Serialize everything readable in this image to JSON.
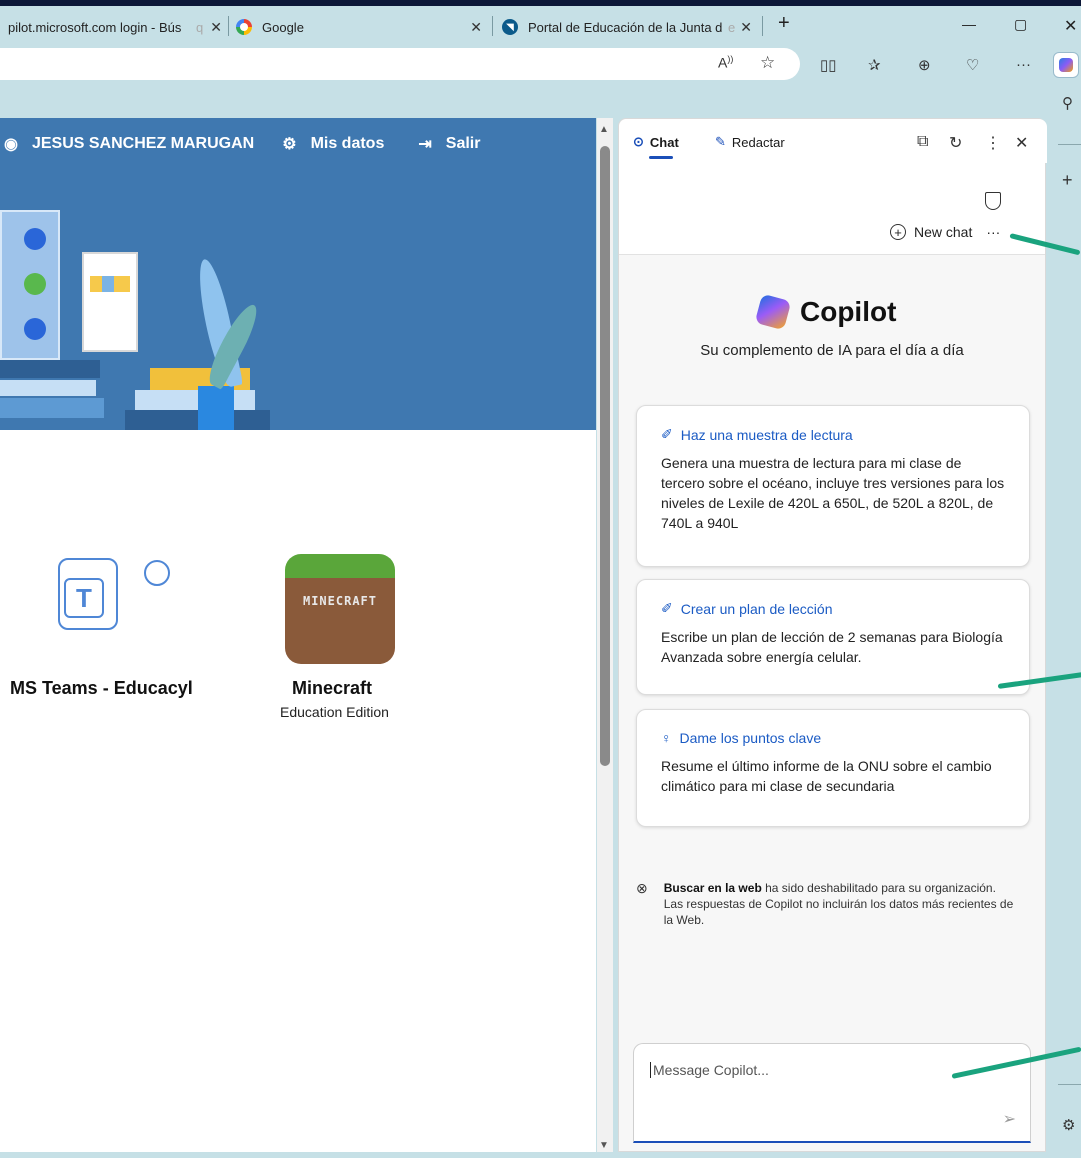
{
  "tabs": [
    {
      "label": "pilot.microsoft.com login - Bús",
      "fade": "q"
    },
    {
      "label": "Google"
    },
    {
      "label": "Portal de Educación de la Junta d",
      "fade": "e"
    }
  ],
  "header": {
    "user_name": "JESUS SANCHEZ MARUGAN",
    "my_data": "Mis datos",
    "logout": "Salir"
  },
  "apps": [
    {
      "name": "MS Teams - Educacyl",
      "sub": ""
    },
    {
      "name": "Minecraft",
      "sub": "Education Edition",
      "tile_text": "MINECRAFT"
    }
  ],
  "copilot": {
    "tab_chat": "Chat",
    "tab_compose": "Redactar",
    "new_chat": "New chat",
    "title": "Copilot",
    "tagline": "Su complemento de IA para el día a día",
    "cards": [
      {
        "title": "Haz una muestra de lectura",
        "body": "Genera una muestra de lectura para mi clase de tercero sobre el océano, incluye tres versiones para los niveles de Lexile de 420L a 650L, de 520L a 820L, de 740L a 940L",
        "icon": "pencil-sparkle-icon"
      },
      {
        "title": "Crear un plan de lección",
        "body": "Escribe un plan de lección de 2 semanas para Biología Avanzada sobre energía celular.",
        "icon": "pencil-sparkle-icon"
      },
      {
        "title": "Dame los puntos clave",
        "body": "Resume el último informe de la ONU sobre el cambio climático para mi clase de secundaria",
        "icon": "lightbulb-icon"
      }
    ],
    "note_bold": "Buscar en la web",
    "note_rest": " ha sido deshabilitado para su organización. Las respuestas de Copilot no incluirán los datos más recientes de la Web.",
    "input_placeholder": "Message Copilot..."
  },
  "colors": {
    "header_blue": "#3f78b0",
    "accent_blue": "#1b5bc4",
    "annotation_green": "#1aa37e",
    "browser_chrome": "#c6e0e6"
  }
}
